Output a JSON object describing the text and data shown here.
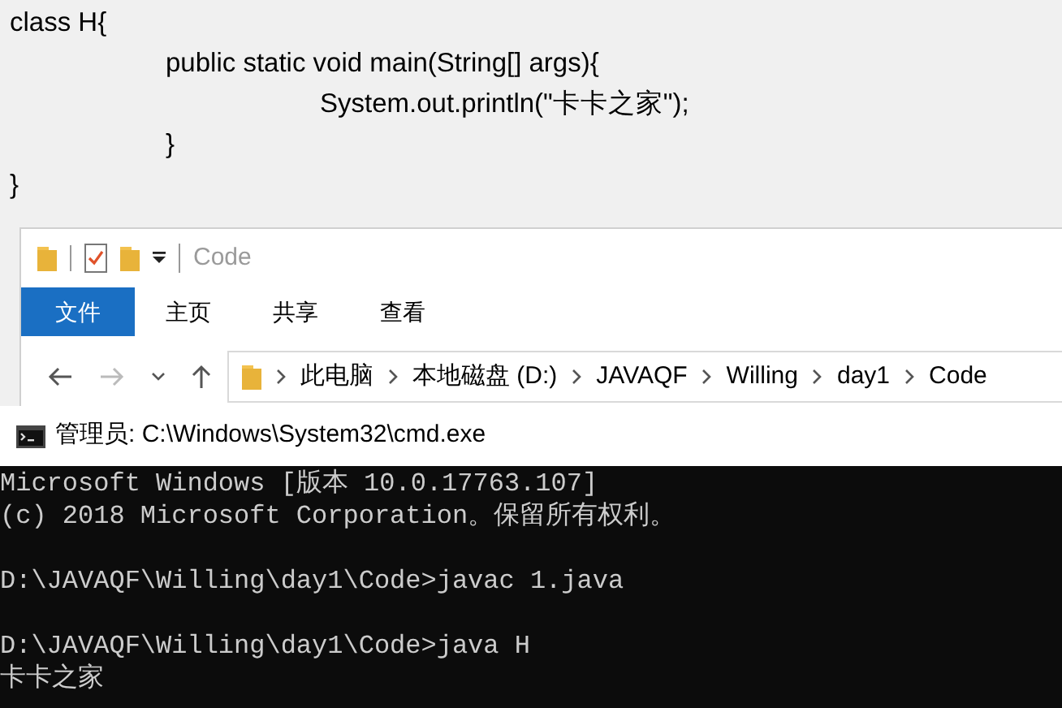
{
  "editor": {
    "lines": [
      {
        "text": "class H{",
        "children": [
          {
            "text": "public static void main(String[] args){",
            "children": [
              {
                "text": "System.out.println(\"卡卡之家\");"
              }
            ]
          },
          {
            "text": "}"
          }
        ]
      },
      {
        "text": "}"
      }
    ]
  },
  "explorer": {
    "title": "Code",
    "tabs": [
      {
        "label": "文件",
        "selected": true
      },
      {
        "label": "主页",
        "selected": false
      },
      {
        "label": "共享",
        "selected": false
      },
      {
        "label": "查看",
        "selected": false
      }
    ],
    "breadcrumb": [
      "此电脑",
      "本地磁盘 (D:)",
      "JAVAQF",
      "Willing",
      "day1",
      "Code"
    ]
  },
  "cmd": {
    "title": "管理员: C:\\Windows\\System32\\cmd.exe",
    "paragraphs": [
      [
        "Microsoft Windows [版本 10.0.17763.107]",
        "(c) 2018 Microsoft Corporation。保留所有权利。"
      ],
      [
        "D:\\JAVAQF\\Willing\\day1\\Code>javac 1.java"
      ],
      [
        "D:\\JAVAQF\\Willing\\day1\\Code>java H",
        "卡卡之家"
      ]
    ]
  }
}
